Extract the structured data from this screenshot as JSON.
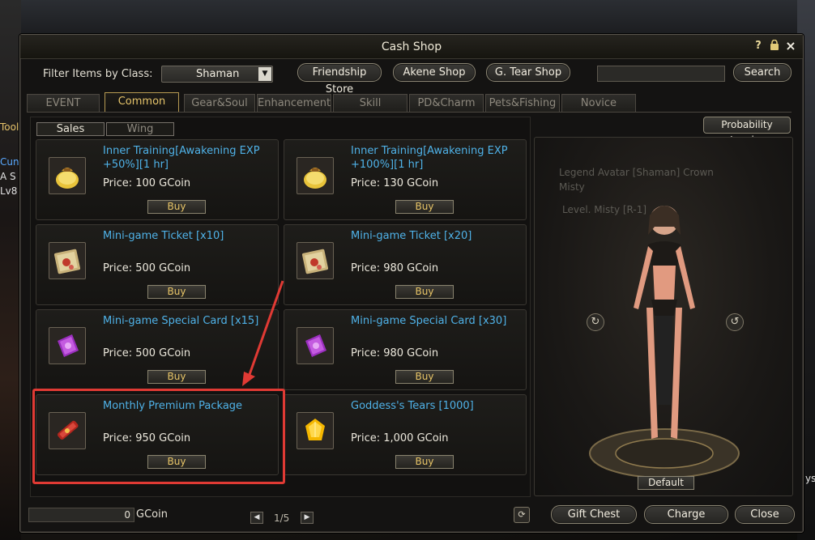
{
  "background": {
    "left_texts": [
      "Tool",
      "Cun",
      "A S",
      "Lv8"
    ],
    "right_text": "ys",
    "preview_labels": [
      "Legend Avatar [Shaman] Crown",
      "Misty",
      "Level. Misty [R-1]"
    ]
  },
  "window": {
    "title": "Cash Shop",
    "icons": [
      "help-icon",
      "lock-icon",
      "close-icon"
    ],
    "help_glyph": "?",
    "close_glyph": "×"
  },
  "filter": {
    "label": "Filter Items by Class:",
    "selected": "Shaman"
  },
  "top_buttons": {
    "friendship": "Friendship Store",
    "akene": "Akene Shop",
    "gtear": "G. Tear Shop",
    "search": "Search",
    "search_value": ""
  },
  "tabs": [
    "EVENT",
    "Common",
    "Gear&Soul",
    "Enhancement",
    "Skill",
    "PD&Charm",
    "Pets&Fishing",
    "Novice"
  ],
  "active_tab": "Common",
  "subtabs": [
    "Sales",
    "Wing"
  ],
  "items": [
    {
      "name": "Inner Training[Awakening EXP +50%][1 hr]",
      "price": "Price: 100 GCoin",
      "buy": "Buy",
      "icon": "pouch-icon"
    },
    {
      "name": "Inner Training[Awakening EXP +100%][1 hr]",
      "price": "Price: 130 GCoin",
      "buy": "Buy",
      "icon": "pouch-icon"
    },
    {
      "name": "Mini-game Ticket [x10]",
      "price": "Price: 500 GCoin",
      "buy": "Buy",
      "icon": "ticket-icon"
    },
    {
      "name": "Mini-game Ticket [x20]",
      "price": "Price: 980 GCoin",
      "buy": "Buy",
      "icon": "ticket-icon"
    },
    {
      "name": "Mini-game Special Card [x15]",
      "price": "Price: 500 GCoin",
      "buy": "Buy",
      "icon": "special-card-icon"
    },
    {
      "name": "Mini-game Special Card [x30]",
      "price": "Price: 980 GCoin",
      "buy": "Buy",
      "icon": "special-card-icon"
    },
    {
      "name": "Monthly Premium Package",
      "price": "Price: 950 GCoin",
      "buy": "Buy",
      "icon": "scroll-package-icon"
    },
    {
      "name": "Goddess's Tears [1000]",
      "price": "Price: 1,000 GCoin",
      "buy": "Buy",
      "icon": "yellow-gem-icon"
    }
  ],
  "pager": {
    "text": "1/5"
  },
  "preview": {
    "probability_button": "Probability Inquiry",
    "default_button": "Default"
  },
  "footer": {
    "gcoin_value": "0",
    "gcoin_label": "GCoin",
    "gift_chest": "Gift Chest",
    "charge": "Charge",
    "close": "Close"
  }
}
